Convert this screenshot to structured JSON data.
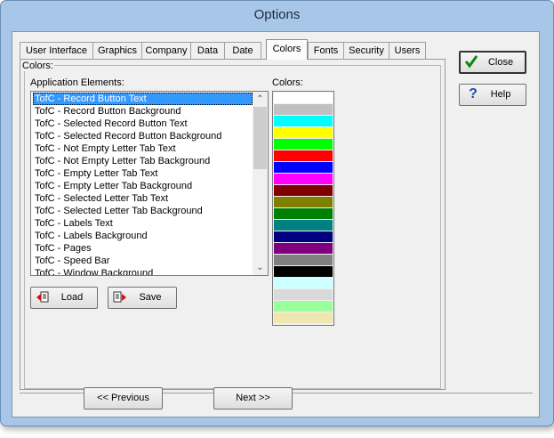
{
  "window": {
    "title": "Options"
  },
  "tabs": [
    {
      "label": "User Interface"
    },
    {
      "label": "Graphics"
    },
    {
      "label": "Company"
    },
    {
      "label": "Data"
    },
    {
      "label": "Date"
    },
    {
      "label": "Colors"
    },
    {
      "label": "Fonts"
    },
    {
      "label": "Security"
    },
    {
      "label": "Users"
    }
  ],
  "colors_group": {
    "title": "Colors:",
    "elements_label": "Application Elements:",
    "colors_label": "Colors:",
    "elements": [
      "TofC - Record Button Text",
      "TofC - Record Button Background",
      "TofC - Selected Record Button Text",
      "TofC - Selected Record Button Background",
      "TofC - Not Empty Letter Tab Text",
      "TofC - Not Empty Letter Tab Background",
      "TofC - Empty Letter Tab Text",
      "TofC - Empty Letter Tab Background",
      "TofC - Selected Letter Tab Text",
      "TofC - Selected Letter Tab Background",
      "TofC - Labels Text",
      "TofC - Labels Background",
      "TofC - Pages",
      "TofC - Speed Bar",
      "TofC - Window Background"
    ],
    "selected_index": 0,
    "swatches": [
      "#ffffff",
      "#c0c0c0",
      "#00ffff",
      "#ffff00",
      "#00ff00",
      "#ff0000",
      "#0000ff",
      "#ff00ff",
      "#800000",
      "#808000",
      "#008000",
      "#008080",
      "#000080",
      "#800080",
      "#808080",
      "#000000",
      "#ccffff",
      "#d9d9d9",
      "#99ff99",
      "#f0e6b0"
    ]
  },
  "buttons": {
    "load": "Load",
    "save": "Save",
    "close": "Close",
    "help": "Help",
    "previous": "<< Previous",
    "next": "Next >>"
  },
  "icons": {
    "load": "load-icon",
    "save": "save-icon",
    "close": "checkmark-icon",
    "help": "question-mark-icon"
  }
}
